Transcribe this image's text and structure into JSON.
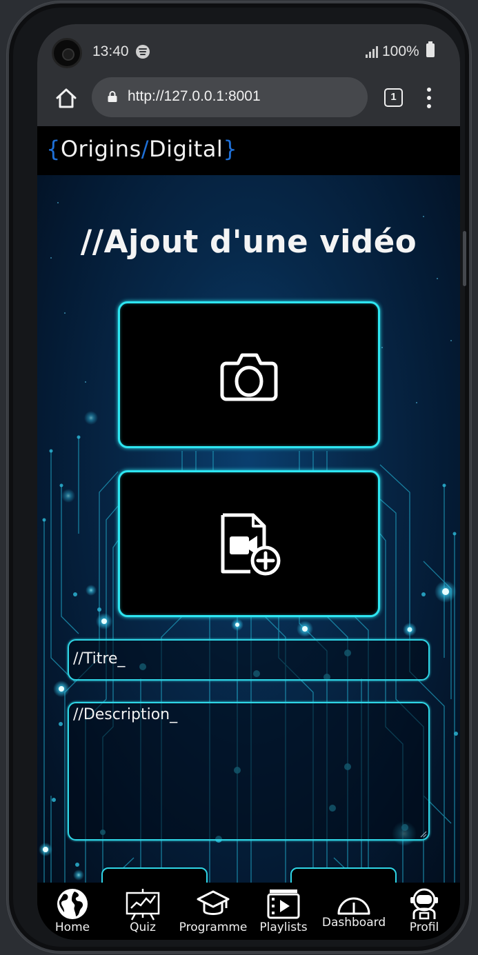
{
  "status_bar": {
    "time": "13:40",
    "battery": "100%",
    "icons": [
      "camera-icon",
      "spotify-icon",
      "signal-icon",
      "battery-icon"
    ]
  },
  "browser": {
    "url": "http://127.0.0.1:8001",
    "tab_count": "1",
    "icons": [
      "home-icon",
      "lock-icon",
      "tabs-icon",
      "more-vert-icon"
    ]
  },
  "site": {
    "logo_open": "{",
    "logo_origins": "Origins",
    "logo_slash": "/",
    "logo_digital": "Digital",
    "logo_close": "}"
  },
  "page": {
    "title": "//Ajout d'une vidéo",
    "photo_upload_icon": "camera-icon",
    "video_upload_icon": "video-file-add-icon"
  },
  "form": {
    "title_placeholder": "//Titre_",
    "description_placeholder": "//Description_"
  },
  "nav": {
    "items": [
      {
        "label": "Home",
        "icon": "globe-icon"
      },
      {
        "label": "Quiz",
        "icon": "presentation-chart-icon"
      },
      {
        "label": "Programme",
        "icon": "graduation-cap-icon"
      },
      {
        "label": "Playlists",
        "icon": "playlist-video-icon"
      },
      {
        "label": "Dashboard",
        "icon": "gauge-icon"
      },
      {
        "label": "Profil",
        "icon": "astronaut-icon"
      }
    ]
  },
  "colors": {
    "accent": "#2ee6f2",
    "logo_brace": "#1e6fd6",
    "background_deep": "#041a33"
  }
}
